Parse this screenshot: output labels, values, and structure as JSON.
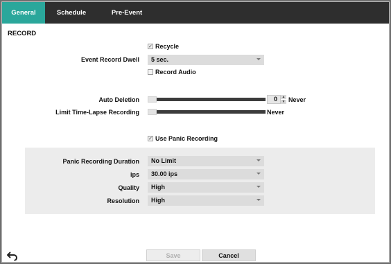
{
  "tabs": [
    {
      "label": "General",
      "active": true
    },
    {
      "label": "Schedule",
      "active": false
    },
    {
      "label": "Pre-Event",
      "active": false
    }
  ],
  "section_title": "RECORD",
  "recycle": {
    "label": "Recycle",
    "checked": true
  },
  "event_record_dwell": {
    "label": "Event Record Dwell",
    "value": "5 sec."
  },
  "record_audio": {
    "label": "Record Audio",
    "checked": false
  },
  "auto_deletion": {
    "label": "Auto Deletion",
    "value": "0",
    "unit_text": "Never"
  },
  "limit_timelapse": {
    "label": "Limit Time-Lapse Recording",
    "value_text": "Never"
  },
  "use_panic": {
    "label": "Use Panic Recording",
    "checked": true
  },
  "panic": {
    "duration": {
      "label": "Panic Recording Duration",
      "value": "No Limit"
    },
    "ips": {
      "label": "ips",
      "value": "30.00 ips"
    },
    "quality": {
      "label": "Quality",
      "value": "High"
    },
    "resolution": {
      "label": "Resolution",
      "value": "High"
    }
  },
  "buttons": {
    "save": "Save",
    "cancel": "Cancel"
  },
  "icons": {
    "back": "back-arrow-icon",
    "check": "checkmark-icon"
  },
  "colors": {
    "tab_active": "#2aa79b",
    "tabbar": "#2e2e2e",
    "panel": "#ececec"
  }
}
